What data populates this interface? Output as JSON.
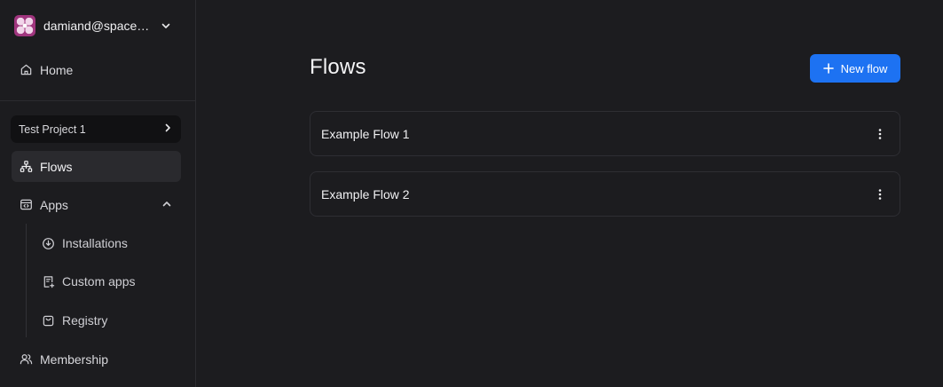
{
  "account": {
    "name": "damiand@spaceli..."
  },
  "sidebar": {
    "home_label": "Home",
    "project_label": "Test Project 1",
    "flows_label": "Flows",
    "apps_label": "Apps",
    "apps_children": [
      {
        "label": "Installations"
      },
      {
        "label": "Custom apps"
      },
      {
        "label": "Registry"
      }
    ],
    "membership_label": "Membership"
  },
  "main": {
    "title": "Flows",
    "new_flow_label": "New flow",
    "flows": [
      {
        "name": "Example Flow 1"
      },
      {
        "name": "Example Flow 2"
      }
    ]
  },
  "colors": {
    "background": "#1c1c1f",
    "accent": "#1d72f2",
    "active_item": "#2a2a2e",
    "border": "#2e2e33"
  }
}
